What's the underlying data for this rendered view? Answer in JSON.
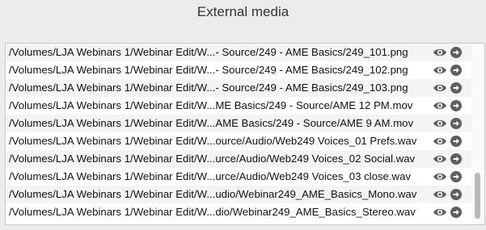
{
  "title": "External media",
  "rows": [
    {
      "path": "/Volumes/LJA Webinars 1/Webinar Edit/W...- Source/249 - AME Basics/249_101.png"
    },
    {
      "path": "/Volumes/LJA Webinars 1/Webinar Edit/W...- Source/249 - AME Basics/249_102.png"
    },
    {
      "path": "/Volumes/LJA Webinars 1/Webinar Edit/W...- Source/249 - AME Basics/249_103.png"
    },
    {
      "path": "/Volumes/LJA Webinars 1/Webinar Edit/W...ME Basics/249 - Source/AME 12 PM.mov"
    },
    {
      "path": "/Volumes/LJA Webinars 1/Webinar Edit/W...AME Basics/249 - Source/AME 9 AM.mov"
    },
    {
      "path": "/Volumes/LJA Webinars 1/Webinar Edit/W...ource/Audio/Web249 Voices_01 Prefs.wav"
    },
    {
      "path": "/Volumes/LJA Webinars 1/Webinar Edit/W...urce/Audio/Web249 Voices_02 Social.wav"
    },
    {
      "path": "/Volumes/LJA Webinars 1/Webinar Edit/W...urce/Audio/Web249 Voices_03 close.wav"
    },
    {
      "path": "/Volumes/LJA Webinars 1/Webinar Edit/W...udio/Webinar249_AME_Basics_Mono.wav"
    },
    {
      "path": "/Volumes/LJA Webinars 1/Webinar Edit/W...dio/Webinar249_AME_Basics_Stereo.wav"
    }
  ],
  "icons": {
    "reveal": "eye-icon",
    "open": "arrow-circle-right-icon"
  },
  "colors": {
    "icon": "#5f5f5f",
    "row_alt": "#f4f4f4"
  }
}
